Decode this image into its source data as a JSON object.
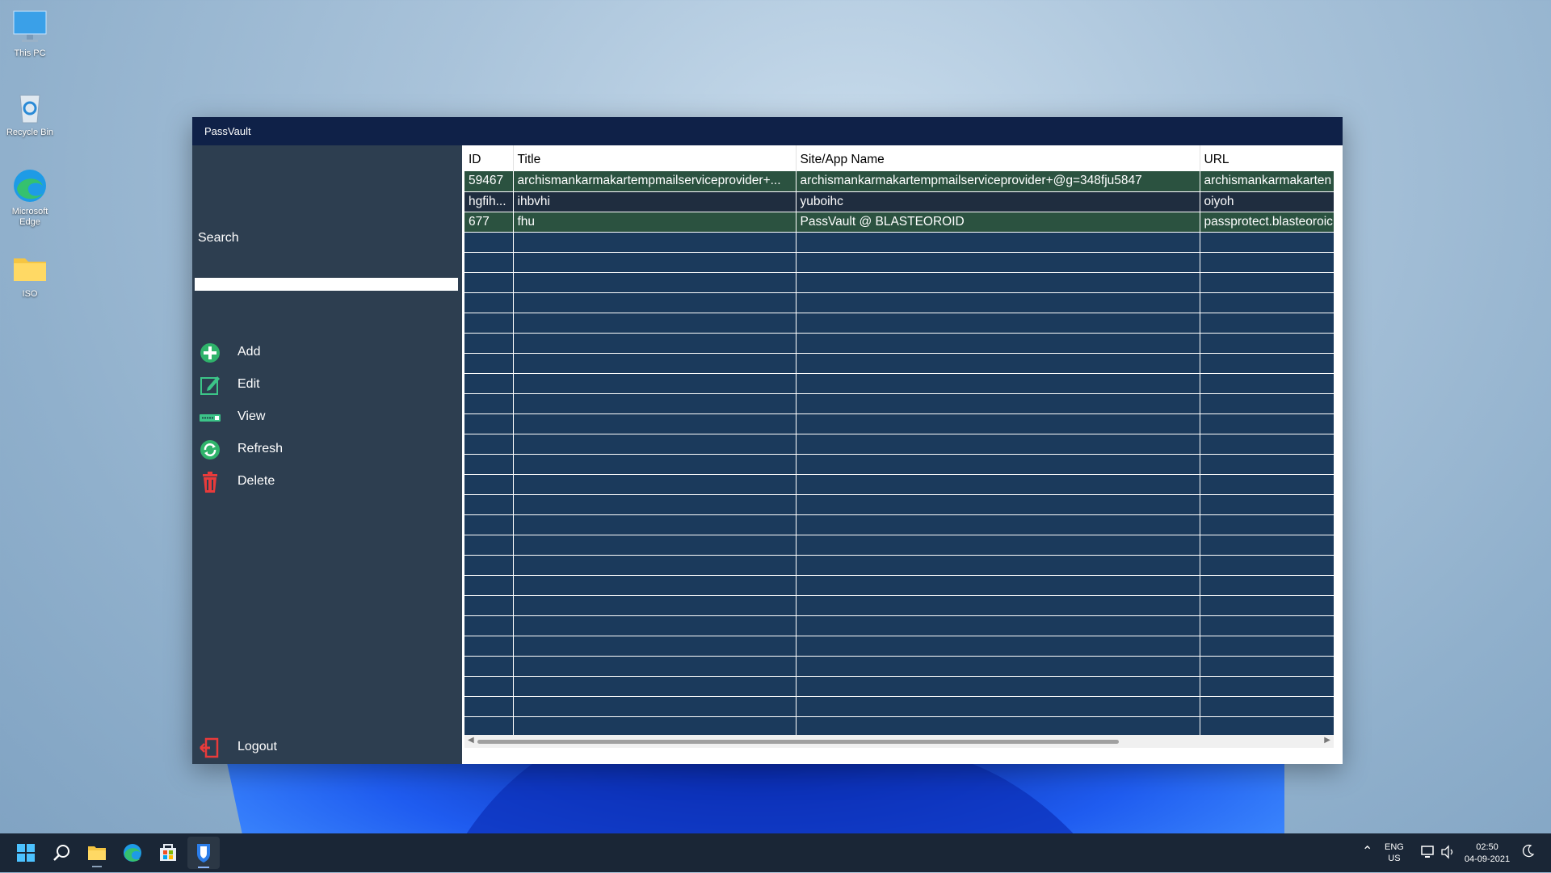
{
  "desktop": {
    "icons": [
      {
        "label": "This PC"
      },
      {
        "label": "Recycle Bin"
      },
      {
        "label": "Microsoft Edge"
      },
      {
        "label": "ISO"
      }
    ]
  },
  "window": {
    "title": "PassVault"
  },
  "sidebar": {
    "search_label": "Search",
    "search_value": "",
    "menu": [
      {
        "label": "Add",
        "icon": "add-icon"
      },
      {
        "label": "Edit",
        "icon": "edit-icon"
      },
      {
        "label": "View",
        "icon": "view-icon"
      },
      {
        "label": "Refresh",
        "icon": "refresh-icon"
      },
      {
        "label": "Delete",
        "icon": "delete-icon"
      }
    ],
    "logout_label": "Logout"
  },
  "grid": {
    "columns": [
      "ID",
      "Title",
      "Site/App Name",
      "URL"
    ],
    "rows": [
      {
        "id": "59467",
        "title": "archismankarmakartempmailserviceprovider+...",
        "site": "archismankarmakartempmailserviceprovider+@g=348fju5847",
        "url": "archismankarmakarten"
      },
      {
        "id": "hgfih...",
        "title": "ihbvhi",
        "site": "yuboihc",
        "url": "oiyoh"
      },
      {
        "id": "677",
        "title": "fhu",
        "site": "PassVault @ BLASTEOROID",
        "url": "passprotect.blasteoroic"
      }
    ],
    "colors": {
      "row_green": "#2b5240",
      "row_dark": "#1f2d3f",
      "row_empty": "#1b3a5c"
    }
  },
  "taskbar": {
    "lang_top": "ENG",
    "lang_bottom": "US",
    "time": "02:50",
    "date": "04-09-2021"
  }
}
